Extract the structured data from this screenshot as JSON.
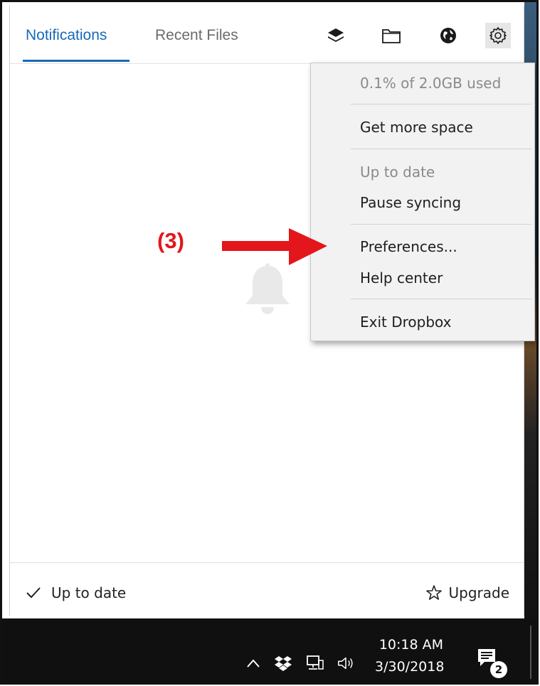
{
  "header": {
    "tabs": [
      {
        "label": "Notifications",
        "active": true
      },
      {
        "label": "Recent Files",
        "active": false
      }
    ],
    "icons": [
      "layers-icon",
      "folder-icon",
      "globe-icon",
      "gear-icon"
    ]
  },
  "menu": {
    "usage": "0.1% of 2.0GB used",
    "get_more_space": "Get more space",
    "sync_status": "Up to date",
    "pause_syncing": "Pause syncing",
    "preferences": "Preferences...",
    "help_center": "Help center",
    "exit": "Exit Dropbox"
  },
  "annotation": {
    "label": "(3)",
    "color": "#e3161b"
  },
  "footer": {
    "status": "Up to date",
    "upgrade": "Upgrade"
  },
  "taskbar": {
    "time": "10:18 AM",
    "date": "3/30/2018",
    "notification_count": "2"
  },
  "colors": {
    "accent": "#1769b8",
    "menu_bg": "#f2f2f2",
    "taskbar_bg": "#101010"
  }
}
